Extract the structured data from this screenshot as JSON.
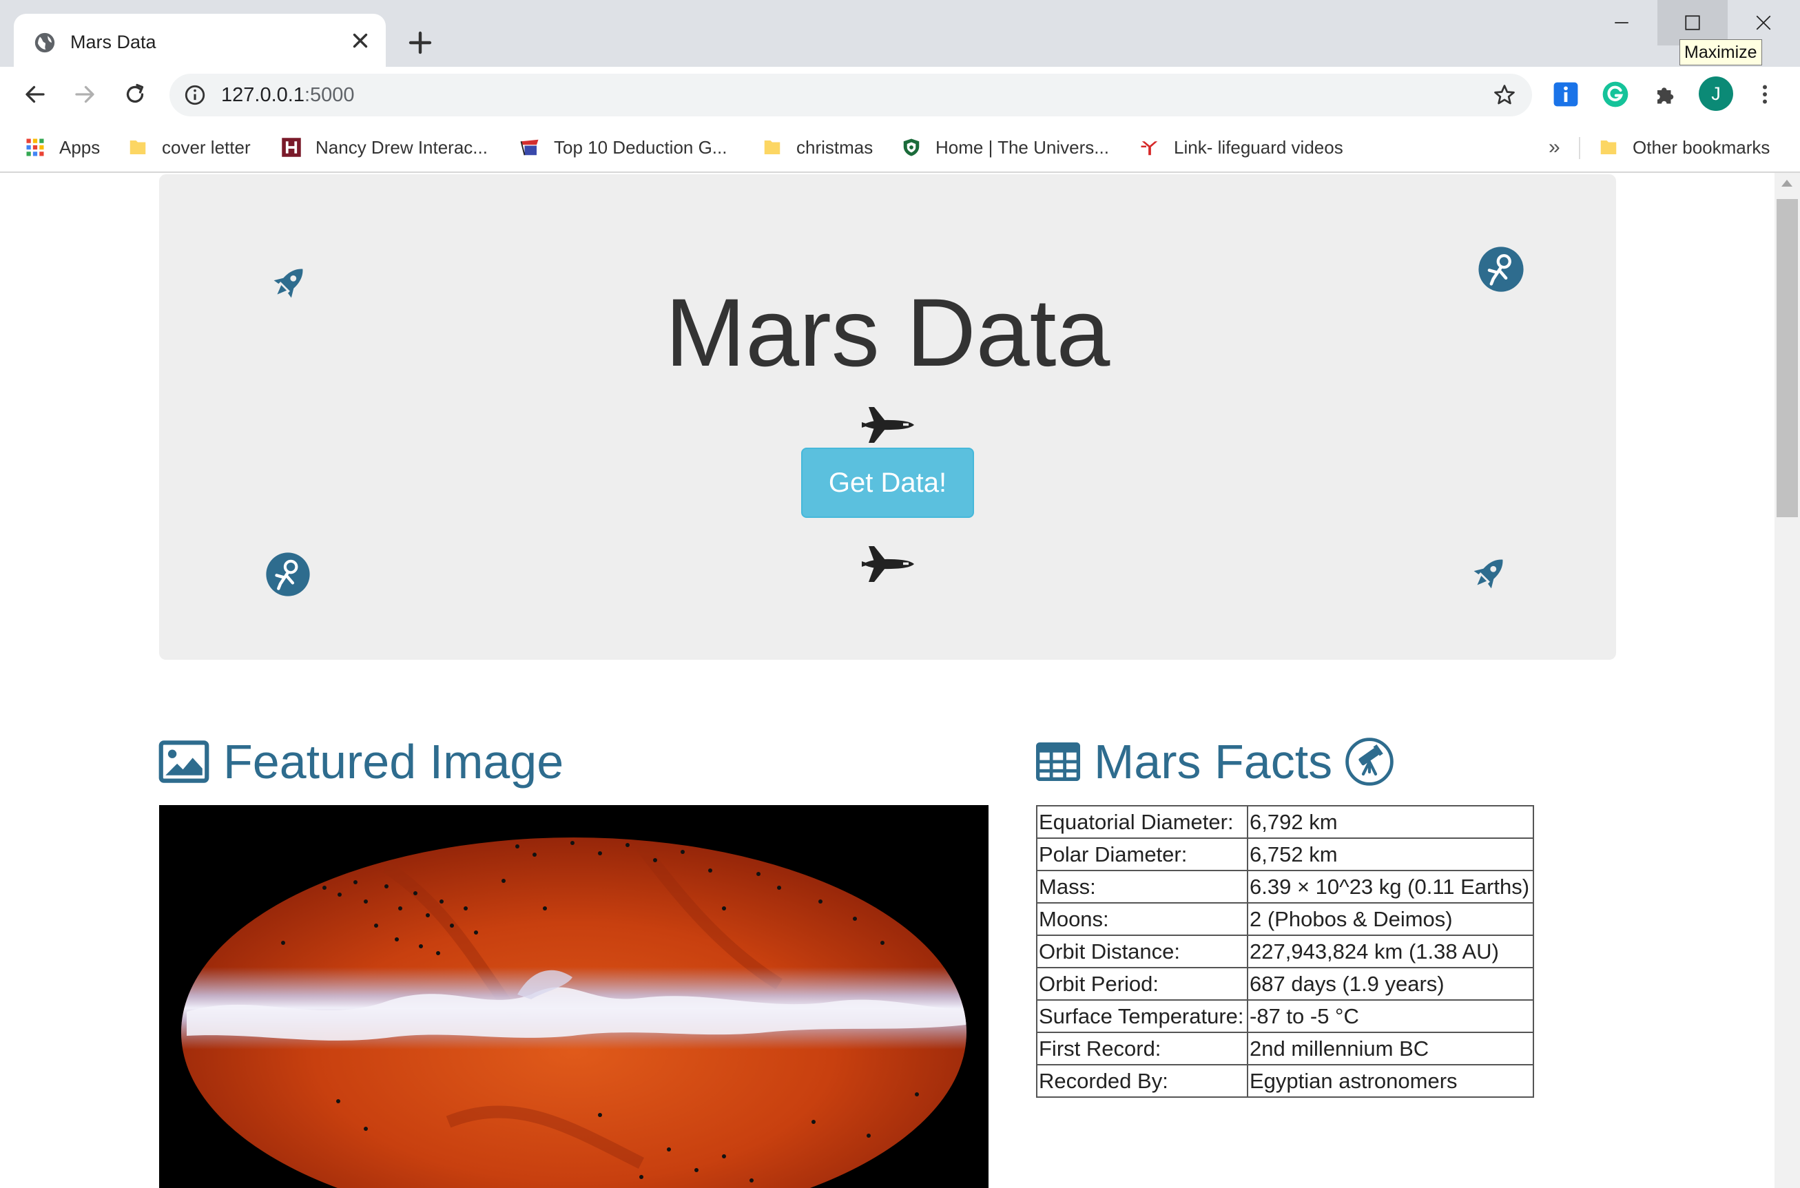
{
  "browser": {
    "tab_title": "Mars Data",
    "tooltip": "Maximize",
    "url_host": "127.0.0.1",
    "url_port": ":5000",
    "profile_initial": "J",
    "bookmarks_overflow": "»",
    "bookmarks": [
      {
        "label": "Apps",
        "icon": "apps-grid-icon"
      },
      {
        "label": "cover letter",
        "icon": "folder-icon"
      },
      {
        "label": "Nancy Drew Interac...",
        "icon": "h-logo-icon"
      },
      {
        "label": "Top 10 Deduction G...",
        "icon": "site-icon"
      },
      {
        "label": "christmas",
        "icon": "folder-icon"
      },
      {
        "label": "Home | The Univers...",
        "icon": "shield-icon"
      },
      {
        "label": "Link- lifeguard videos",
        "icon": "ymca-icon"
      },
      {
        "label": "Other bookmarks",
        "icon": "folder-icon"
      }
    ]
  },
  "page": {
    "title": "Mars Data",
    "button_label": "Get Data!",
    "featured_heading": "Featured Image",
    "facts_heading": "Mars Facts",
    "facts": [
      {
        "key": "Equatorial Diameter:",
        "value": "6,792 km"
      },
      {
        "key": "Polar Diameter:",
        "value": "6,752 km"
      },
      {
        "key": "Mass:",
        "value": "6.39 × 10^23 kg (0.11 Earths)"
      },
      {
        "key": "Moons:",
        "value": "2 (Phobos & Deimos)"
      },
      {
        "key": "Orbit Distance:",
        "value": "227,943,824 km (1.38 AU)"
      },
      {
        "key": "Orbit Period:",
        "value": "687 days (1.9 years)"
      },
      {
        "key": "Surface Temperature:",
        "value": "-87 to -5 °C"
      },
      {
        "key": "First Record:",
        "value": "2nd millennium BC"
      },
      {
        "key": "Recorded By:",
        "value": "Egyptian astronomers"
      }
    ]
  },
  "colors": {
    "accent": "#2e6c8e",
    "button": "#5bc0de",
    "jumbotron": "#eeeeee"
  }
}
